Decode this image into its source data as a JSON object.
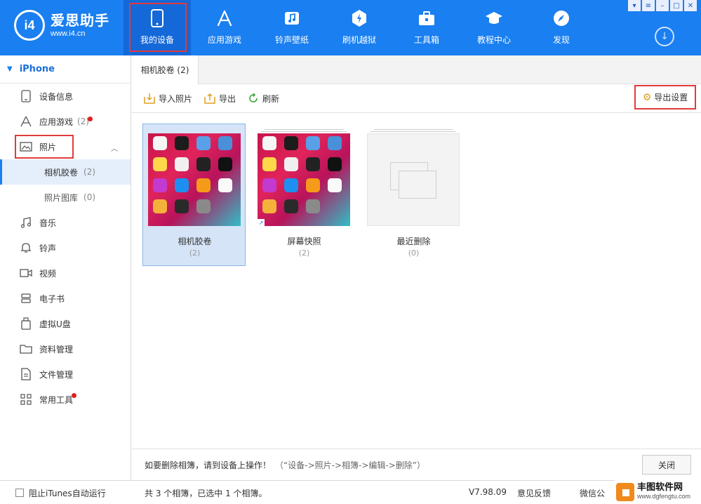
{
  "app": {
    "logo_badge": "i4",
    "name": "爱思助手",
    "url": "www.i4.cn"
  },
  "nav": [
    {
      "label": "我的设备",
      "icon": "phone-icon"
    },
    {
      "label": "应用游戏",
      "icon": "app-store-icon"
    },
    {
      "label": "铃声壁纸",
      "icon": "music-icon"
    },
    {
      "label": "刷机越狱",
      "icon": "flash-icon"
    },
    {
      "label": "工具箱",
      "icon": "toolbox-icon"
    },
    {
      "label": "教程中心",
      "icon": "graduation-cap-icon"
    },
    {
      "label": "发现",
      "icon": "compass-icon"
    }
  ],
  "window_controls": [
    "shirt-icon",
    "menu-icon",
    "minimize-icon",
    "maximize-icon",
    "close-icon"
  ],
  "sidebar": {
    "device": "iPhone",
    "items": [
      {
        "label": "设备信息",
        "icon": "device-info-icon"
      },
      {
        "label": "应用游戏",
        "count": "(2)",
        "icon": "app-icon",
        "badge": true
      },
      {
        "label": "照片",
        "icon": "photo-icon"
      },
      {
        "label": "相机胶卷",
        "count": "(2)",
        "sub": true
      },
      {
        "label": "照片图库",
        "count": "(0)",
        "sub": true
      },
      {
        "label": "音乐",
        "icon": "music-note-icon"
      },
      {
        "label": "铃声",
        "icon": "bell-icon"
      },
      {
        "label": "视频",
        "icon": "video-icon"
      },
      {
        "label": "电子书",
        "icon": "book-icon"
      },
      {
        "label": "虚拟U盘",
        "icon": "usb-drive-icon"
      },
      {
        "label": "资料管理",
        "icon": "folder-icon"
      },
      {
        "label": "文件管理",
        "icon": "file-icon"
      },
      {
        "label": "常用工具",
        "icon": "tools-grid-icon",
        "badge": true
      }
    ]
  },
  "tab": {
    "label": "相机胶卷 (2)"
  },
  "toolbar": {
    "import_label": "导入照片",
    "export_label": "导出",
    "refresh_label": "刷新",
    "export_settings_label": "导出设置"
  },
  "albums": [
    {
      "name": "相机胶卷",
      "count": "(2)",
      "selected": true
    },
    {
      "name": "屏幕快照",
      "count": "(2)",
      "selected": false
    },
    {
      "name": "最近删除",
      "count": "(0)",
      "selected": false
    }
  ],
  "bottom": {
    "note": "如要删除相簿，请到设备上操作！",
    "hint": "（“设备->照片->相簿->编辑->删除”）",
    "close_label": "关闭"
  },
  "status": {
    "itunes_label": "阻止iTunes自动运行",
    "summary": "共 3 个相簿，已选中 1 个相簿。",
    "version": "V7.98.09",
    "feedback": "意见反馈",
    "wechat": "微信公"
  },
  "watermark": {
    "title": "丰图软件网",
    "url": "www.dgfengtu.com"
  },
  "colors": {
    "header_blue": "#1a7ff0",
    "highlight_red": "#e23a3a",
    "selected_bg": "#d5e4f7"
  }
}
